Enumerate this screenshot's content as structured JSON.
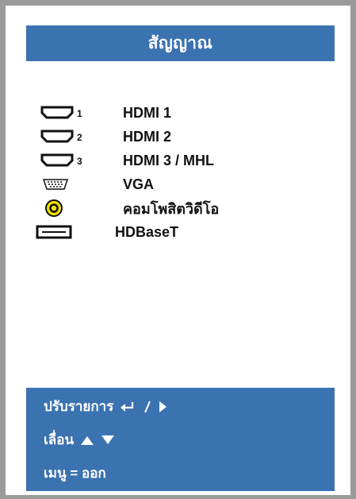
{
  "menu": {
    "title": "สัญญาณ",
    "items": [
      {
        "label": "HDMI 1",
        "icon": "hdmi-icon",
        "sub": "1"
      },
      {
        "label": "HDMI 2",
        "icon": "hdmi-icon",
        "sub": "2"
      },
      {
        "label": "HDMI 3 / MHL",
        "icon": "hdmi-icon",
        "sub": "3"
      },
      {
        "label": "VGA",
        "icon": "vga-icon"
      },
      {
        "label": "คอมโพสิตวิดีโอ",
        "icon": "composite-icon"
      },
      {
        "label": "HDBaseT",
        "icon": "hdbaset-icon"
      }
    ]
  },
  "help": {
    "adjust": "ปรับรายการ",
    "move": "เลื่อน",
    "menu_exit": "เมนู = ออก"
  },
  "colors": {
    "accent": "#3b72b0",
    "frame": "#9a9a9a",
    "composite_yellow": "#f2e200"
  }
}
